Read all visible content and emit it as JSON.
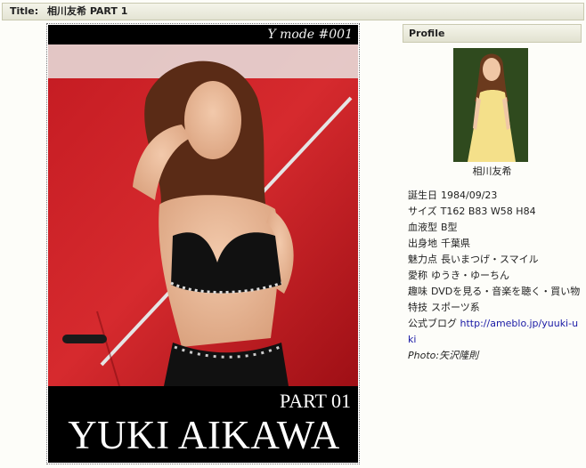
{
  "title_bar": {
    "label": "Title:",
    "value": "相川友希  PART 1"
  },
  "cover": {
    "series": "Y mode #001",
    "part": "PART 01",
    "name": "YUKI AIKAWA"
  },
  "profile": {
    "header": "Profile",
    "caption": "相川友希",
    "rows": [
      {
        "key": "誕生日",
        "value": "1984/09/23"
      },
      {
        "key": "サイズ",
        "value": "T162 B83 W58 H84"
      },
      {
        "key": "血液型",
        "value": "B型"
      },
      {
        "key": "出身地",
        "value": "千葉県"
      },
      {
        "key": "魅力点",
        "value": "長いまつげ・スマイル"
      },
      {
        "key": "愛称",
        "value": "ゆうき・ゆーちん"
      },
      {
        "key": "趣味",
        "value": "DVDを見る・音楽を聴く・買い物"
      },
      {
        "key": "特技",
        "value": "スポーツ系"
      }
    ],
    "blog_label": "公式ブログ",
    "blog_url": "http://ameblo.jp/yuuki-uki",
    "photo_credit": "Photo:矢沢隆則"
  },
  "colors": {
    "link": "#1a1aa6",
    "cover_red": "#c8141c",
    "header_bg": "#e8e8d8"
  }
}
